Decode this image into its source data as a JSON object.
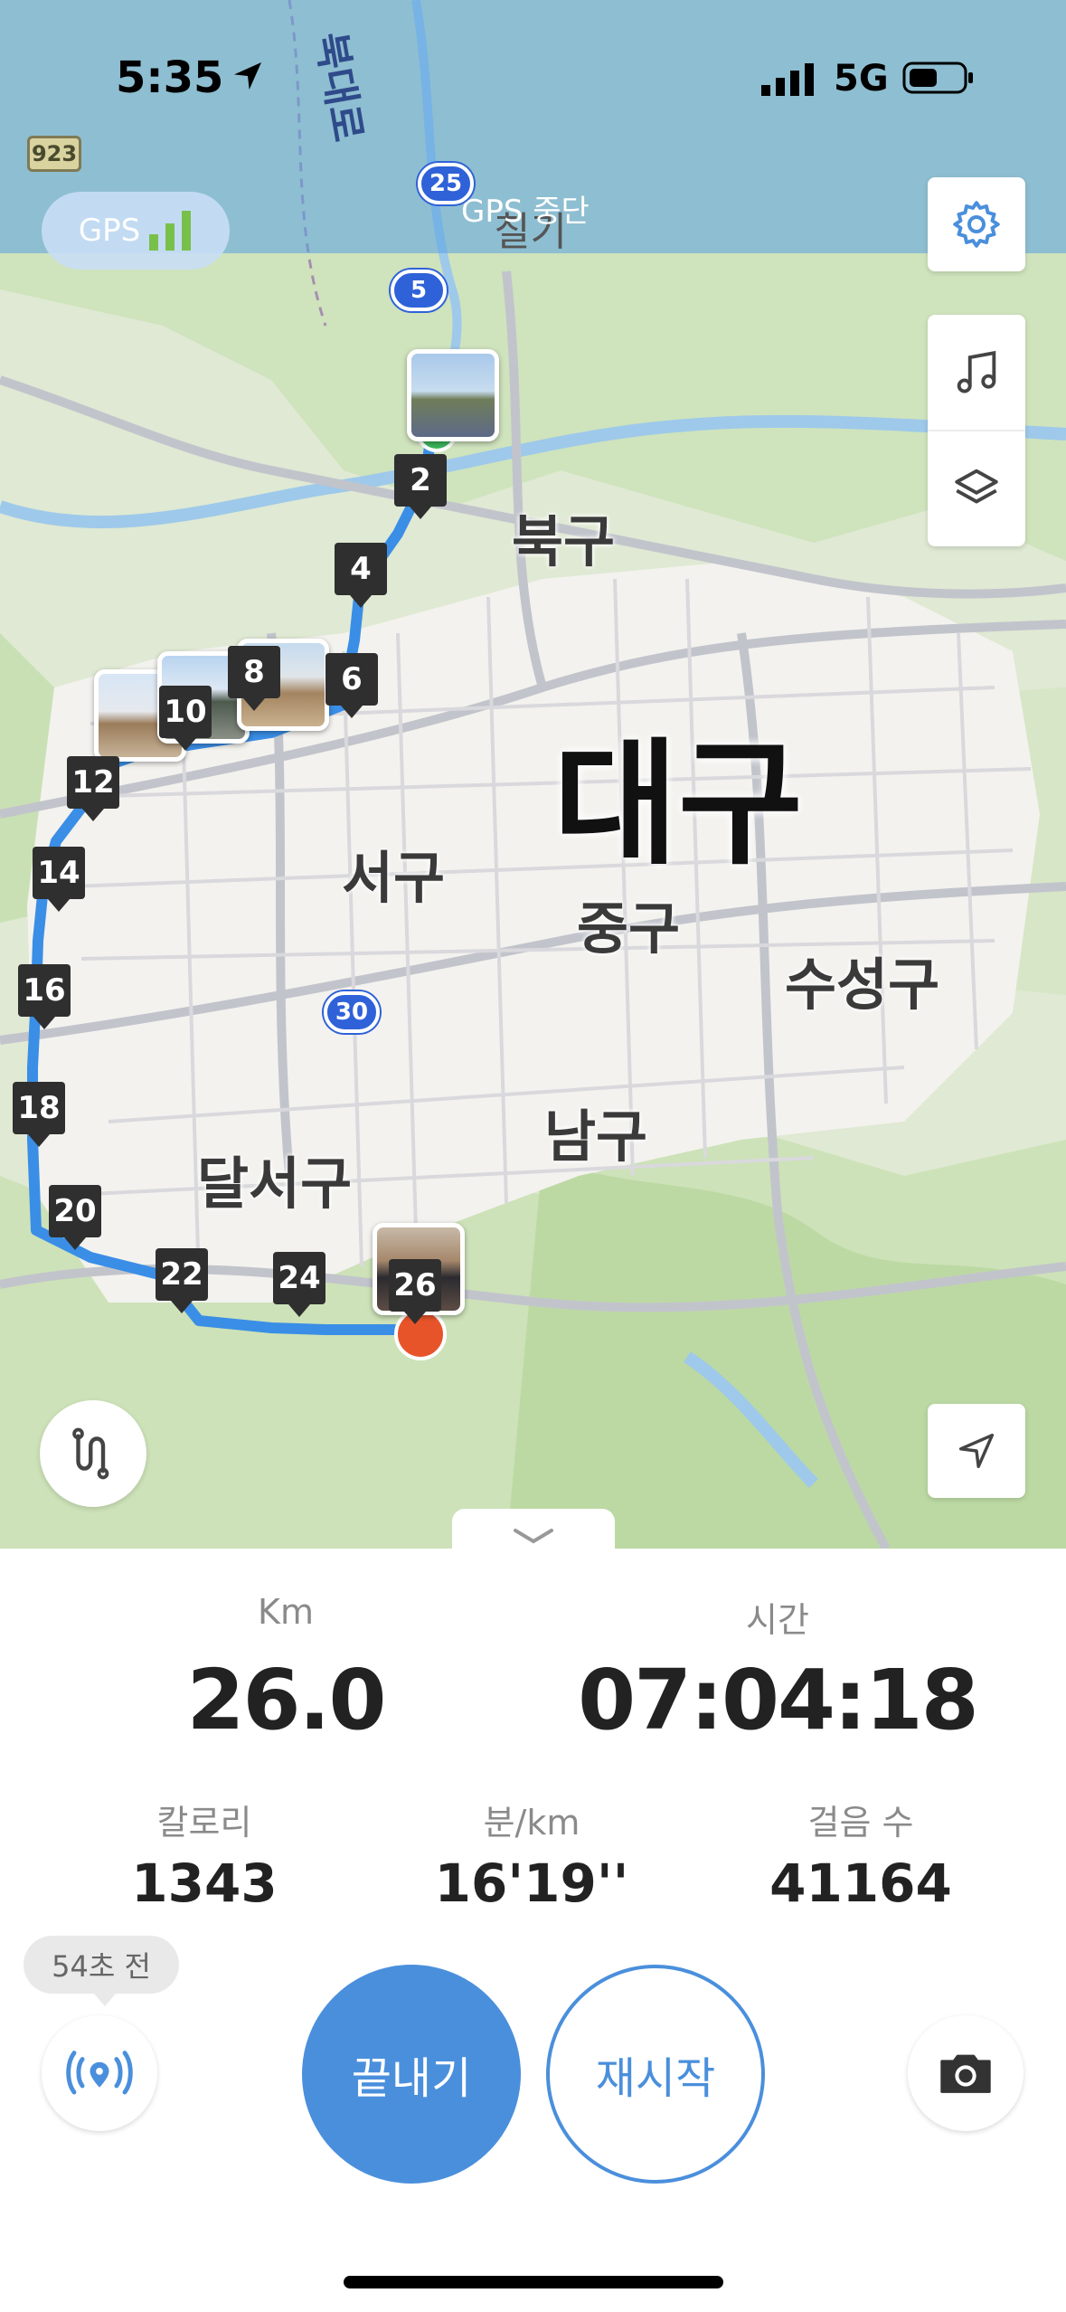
{
  "status_bar": {
    "time": "5:35",
    "network": "5G"
  },
  "map": {
    "gps_label": "GPS",
    "gps_status": "GPS 중단",
    "city_label": "대구",
    "districts": [
      "북구",
      "서구",
      "중구",
      "수성구",
      "남구",
      "달서구"
    ],
    "road_shields": [
      "25",
      "5",
      "30"
    ],
    "route_sign": "923",
    "top_road_label": "북대로",
    "top_place_label": "칠기",
    "km_markers": [
      "2",
      "4",
      "6",
      "8",
      "10",
      "12",
      "14",
      "16",
      "18",
      "20",
      "22",
      "24",
      "26"
    ],
    "route_color": "#3a8ee6",
    "start_color": "#3cb55a",
    "end_color": "#e8542a"
  },
  "stats": {
    "distance_label": "Km",
    "distance_value": "26.0",
    "time_label": "시간",
    "time_value": "07:04:18",
    "calories_label": "칼로리",
    "calories_value": "1343",
    "pace_label": "분/km",
    "pace_value": "16'19''",
    "steps_label": "걸음 수",
    "steps_value": "41164"
  },
  "controls": {
    "broadcast_tooltip": "54초 전",
    "finish_label": "끝내기",
    "resume_label": "재시작",
    "accent_color": "#4a8fdc"
  }
}
